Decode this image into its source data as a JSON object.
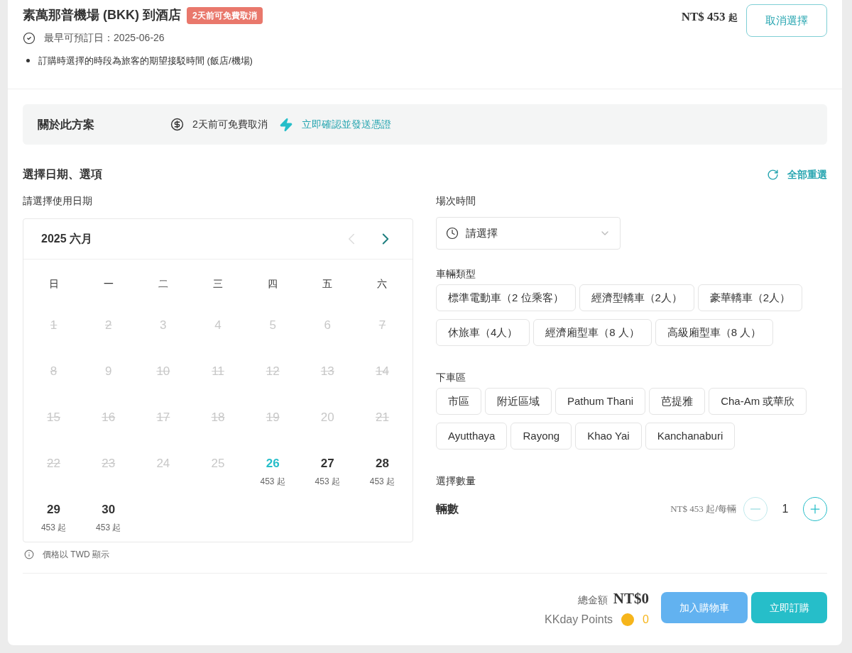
{
  "header": {
    "title": "素萬那普機場 (BKK) 到酒店",
    "badge": "2天前可免費取消",
    "earliest": "最早可預訂日：2025-06-26",
    "note": "訂購時選擇的時段為旅客的期望接駁時間 (飯店/機場)",
    "price": "NT$ 453",
    "price_suffix": "起",
    "cancel_button": "取消選擇"
  },
  "about": {
    "title": "關於此方案",
    "cancel_policy": "2天前可免費取消",
    "instant": "立即確認並發送憑證"
  },
  "section": {
    "title": "選擇日期、選項",
    "reset": "全部重選"
  },
  "calendar": {
    "label": "請選擇使用日期",
    "month": "2025 六月",
    "prev_disabled": true,
    "next_disabled": false,
    "weekdays": [
      "日",
      "一",
      "二",
      "三",
      "四",
      "五",
      "六"
    ],
    "days": [
      {
        "day": "1",
        "disabled": true,
        "struck": true,
        "selected": false
      },
      {
        "day": "2",
        "disabled": true,
        "struck": true,
        "selected": false
      },
      {
        "day": "3",
        "disabled": true,
        "struck": false,
        "selected": false
      },
      {
        "day": "4",
        "disabled": true,
        "struck": false,
        "selected": false
      },
      {
        "day": "5",
        "disabled": true,
        "struck": false,
        "selected": false
      },
      {
        "day": "6",
        "disabled": true,
        "struck": false,
        "selected": false
      },
      {
        "day": "7",
        "disabled": true,
        "struck": true,
        "selected": false
      },
      {
        "day": "8",
        "disabled": true,
        "struck": true,
        "selected": false
      },
      {
        "day": "9",
        "disabled": true,
        "struck": false,
        "selected": false
      },
      {
        "day": "10",
        "disabled": true,
        "struck": true,
        "selected": false
      },
      {
        "day": "11",
        "disabled": true,
        "struck": true,
        "selected": false
      },
      {
        "day": "12",
        "disabled": true,
        "struck": true,
        "selected": false
      },
      {
        "day": "13",
        "disabled": true,
        "struck": true,
        "selected": false
      },
      {
        "day": "14",
        "disabled": true,
        "struck": true,
        "selected": false
      },
      {
        "day": "15",
        "disabled": true,
        "struck": true,
        "selected": false
      },
      {
        "day": "16",
        "disabled": true,
        "struck": true,
        "selected": false
      },
      {
        "day": "17",
        "disabled": true,
        "struck": true,
        "selected": false
      },
      {
        "day": "18",
        "disabled": true,
        "struck": true,
        "selected": false
      },
      {
        "day": "19",
        "disabled": true,
        "struck": true,
        "selected": false
      },
      {
        "day": "20",
        "disabled": true,
        "struck": false,
        "selected": false
      },
      {
        "day": "21",
        "disabled": true,
        "struck": true,
        "selected": false
      },
      {
        "day": "22",
        "disabled": true,
        "struck": true,
        "selected": false
      },
      {
        "day": "23",
        "disabled": true,
        "struck": true,
        "selected": false
      },
      {
        "day": "24",
        "disabled": true,
        "struck": false,
        "selected": false
      },
      {
        "day": "25",
        "disabled": true,
        "struck": false,
        "selected": false
      },
      {
        "day": "26",
        "disabled": false,
        "struck": false,
        "selected": true,
        "price": "453 起"
      },
      {
        "day": "27",
        "disabled": false,
        "struck": false,
        "selected": false,
        "price": "453 起"
      },
      {
        "day": "28",
        "disabled": false,
        "struck": false,
        "selected": false,
        "price": "453 起"
      },
      {
        "day": "29",
        "disabled": false,
        "struck": false,
        "selected": false,
        "price": "453 起"
      },
      {
        "day": "30",
        "disabled": false,
        "struck": false,
        "selected": false,
        "price": "453 起"
      }
    ],
    "currency_note": "價格以 TWD 顯示"
  },
  "session": {
    "label": "場次時間",
    "placeholder": "請選擇"
  },
  "vehicle": {
    "label": "車輛類型",
    "options": [
      {
        "label": "標準電動車（2 位乘客）",
        "selected": false
      },
      {
        "label": "經濟型轎車（2人）",
        "selected": false
      },
      {
        "label": "豪華轎車（2人）",
        "selected": false
      },
      {
        "label": "休旅車（4人）",
        "selected": false
      },
      {
        "label": "經濟廂型車（8 人）",
        "selected": false
      },
      {
        "label": "高級廂型車（8 人）",
        "selected": false
      }
    ]
  },
  "dropoff": {
    "label": "下車區",
    "options": [
      {
        "label": "市區",
        "selected": false
      },
      {
        "label": "附近區域",
        "selected": false
      },
      {
        "label": "Pathum Thani",
        "selected": false
      },
      {
        "label": "芭提雅",
        "selected": false
      },
      {
        "label": "Cha-Am 或華欣",
        "selected": false
      },
      {
        "label": "Ayutthaya",
        "selected": false
      },
      {
        "label": "Rayong",
        "selected": false
      },
      {
        "label": "Khao Yai",
        "selected": false
      },
      {
        "label": "Kanchanaburi",
        "selected": false
      }
    ]
  },
  "quantity": {
    "label": "選擇數量",
    "unit_label": "輛數",
    "unit_price": "NT$ 453",
    "unit_price_suffix": "起/每輛",
    "value": "1",
    "minus_disabled": true,
    "plus_disabled": false
  },
  "footer": {
    "total_label": "總金額",
    "total": "NT$0",
    "points_label": "KKday Points",
    "points": "0",
    "add_to_cart": "加入購物車",
    "book_now": "立即訂購"
  }
}
